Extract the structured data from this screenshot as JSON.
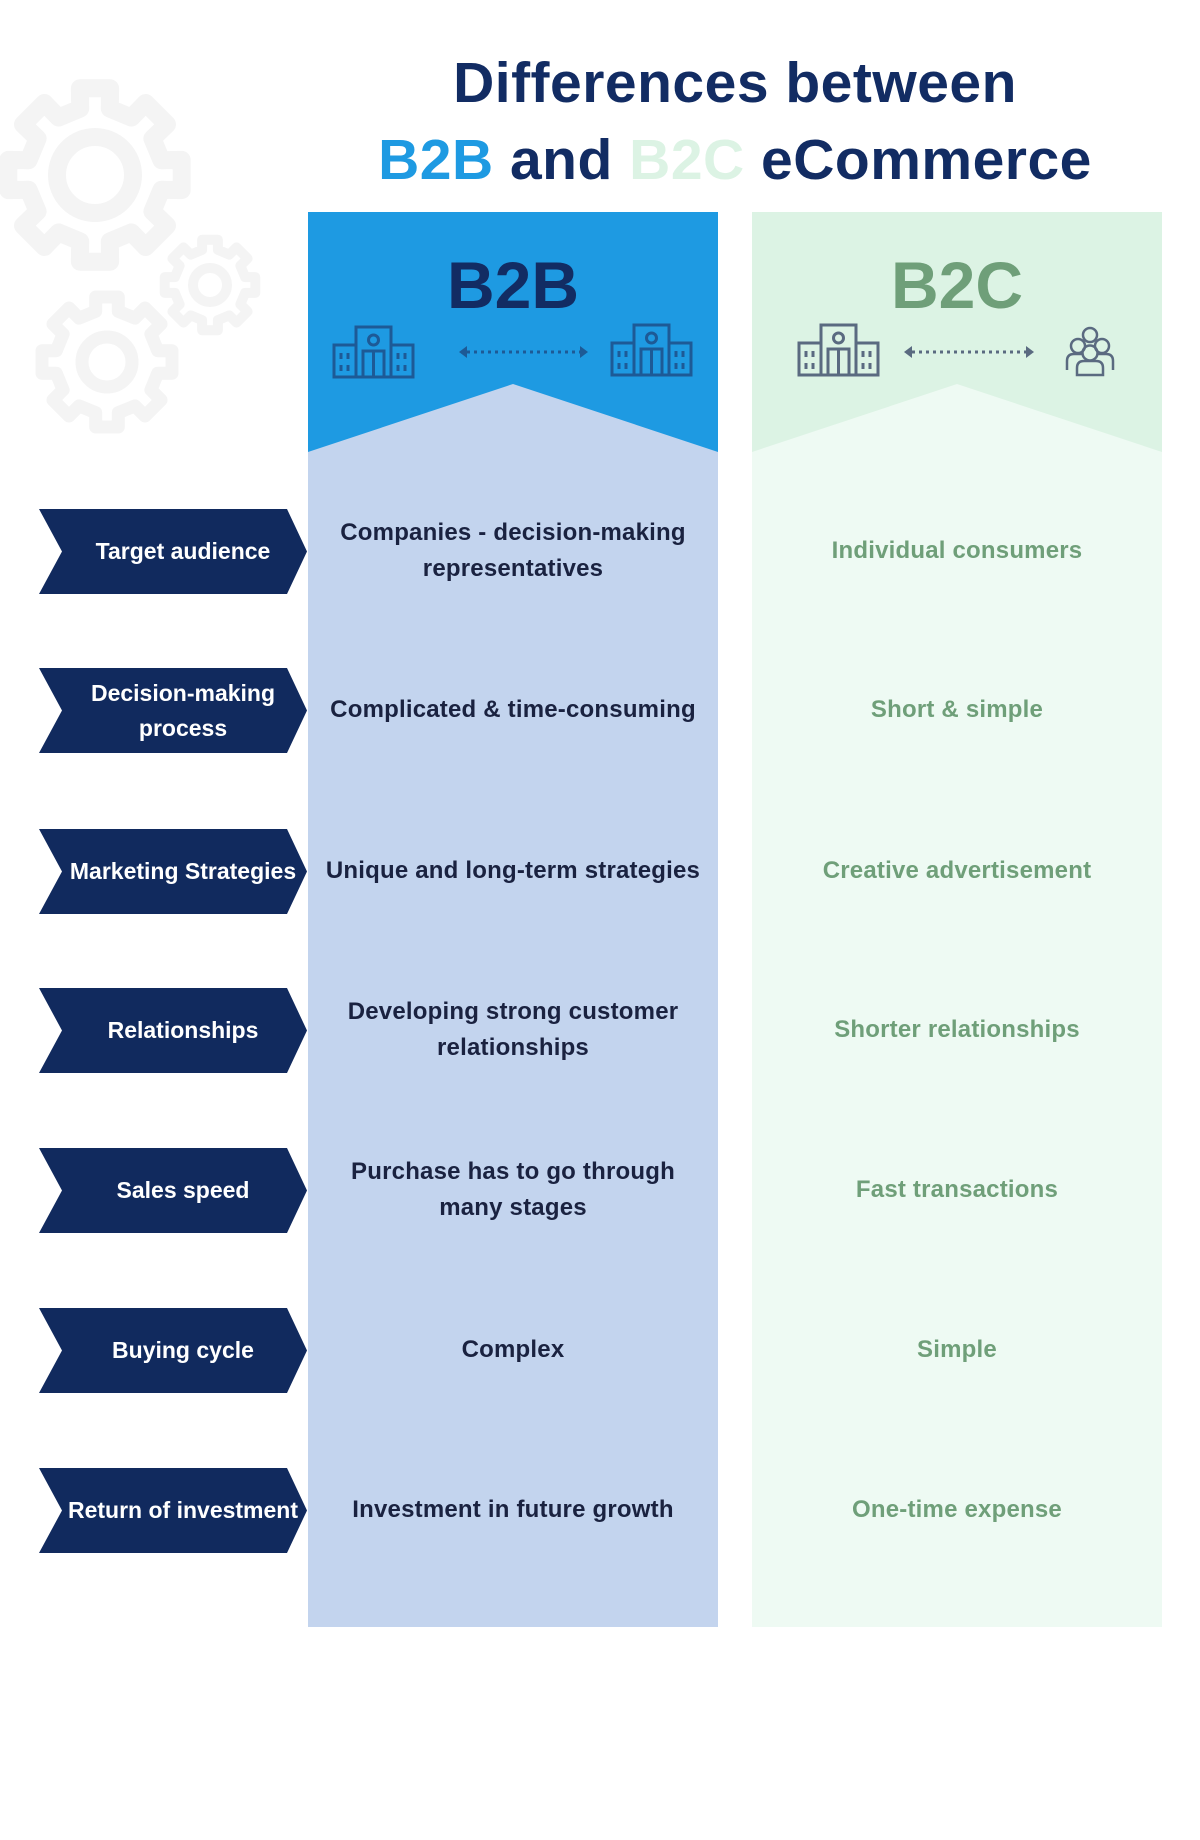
{
  "title": {
    "line1": "Differences between",
    "line2_b2b": "B2B",
    "line2_and": "and",
    "line2_b2c": "B2C",
    "line2_end": "eCommerce"
  },
  "colors": {
    "navy": "#122c63",
    "b2b_blue": "#1e9ae2",
    "b2b_light": "#c3d4ee",
    "b2c_header": "#dcf3e4",
    "b2c_light": "#eefaf3",
    "b2c_text": "#6f9f79",
    "label_bg": "#112a5e"
  },
  "columns": {
    "b2b": {
      "title": "B2B",
      "icons": [
        "building-icon",
        "double-arrow-icon",
        "building-icon"
      ]
    },
    "b2c": {
      "title": "B2C",
      "icons": [
        "building-icon",
        "double-arrow-icon",
        "people-group-icon"
      ]
    }
  },
  "rows": [
    {
      "label": "Target audience",
      "b2b": "Companies - decision-making representatives",
      "b2c": "Individual consumers"
    },
    {
      "label": "Decision-making process",
      "b2b": "Complicated & time-consuming",
      "b2c": "Short & simple"
    },
    {
      "label": "Marketing Strategies",
      "b2b": "Unique and long-term strategies",
      "b2c": "Creative advertisement"
    },
    {
      "label": "Relationships",
      "b2b": "Developing strong customer relationships",
      "b2c": "Shorter relationships"
    },
    {
      "label": "Sales speed",
      "b2b": "Purchase has to go through many stages",
      "b2c": "Fast transactions"
    },
    {
      "label": "Buying cycle",
      "b2b": "Complex",
      "b2c": "Simple"
    },
    {
      "label": "Return of investment",
      "b2b": "Investment in future growth",
      "b2c": "One-time expense"
    }
  ],
  "decor": {
    "background_icons": [
      "gear-icon",
      "gear-icon",
      "gear-icon"
    ]
  }
}
